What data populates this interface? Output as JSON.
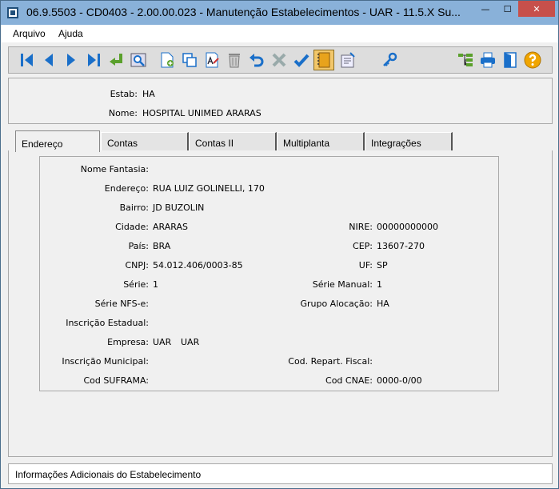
{
  "window": {
    "title": "06.9.5503 - CD0403 - 2.00.00.023 - Manutenção Estabelecimentos - UAR - 11.5.X Su...",
    "controls": {
      "minimize": "—",
      "maximize": "☐",
      "close": "✕"
    }
  },
  "menu": {
    "items": [
      "Arquivo",
      "Ajuda"
    ]
  },
  "toolbar": {
    "icons": [
      "first-record-icon",
      "previous-record-icon",
      "next-record-icon",
      "last-record-icon",
      "goto-icon",
      "search-icon",
      "add-icon",
      "copy-icon",
      "edit-icon",
      "delete-icon",
      "undo-icon",
      "cancel-icon",
      "confirm-icon",
      "notebook-icon",
      "report-icon",
      "key-icon",
      "hierarchy-icon",
      "print-icon",
      "exit-icon",
      "help-icon"
    ]
  },
  "header": {
    "estab_label": "Estab:",
    "estab_value": "HA",
    "nome_label": "Nome:",
    "nome_value": "HOSPITAL UNIMED ARARAS"
  },
  "tabs": [
    {
      "label": "Endereço",
      "selected": true
    },
    {
      "label": "Contas",
      "selected": false
    },
    {
      "label": "Contas II",
      "selected": false
    },
    {
      "label": "Multiplanta",
      "selected": false
    },
    {
      "label": "Integrações",
      "selected": false
    }
  ],
  "form": {
    "nome_fantasia_label": "Nome Fantasia:",
    "nome_fantasia_value": "",
    "endereco_label": "Endereço:",
    "endereco_value": "RUA LUIZ GOLINELLI, 170",
    "bairro_label": "Bairro:",
    "bairro_value": "JD BUZOLIN",
    "cidade_label": "Cidade:",
    "cidade_value": "ARARAS",
    "nire_label": "NIRE:",
    "nire_value": "00000000000",
    "pais_label": "País:",
    "pais_value": "BRA",
    "cep_label": "CEP:",
    "cep_value": "13607-270",
    "cnpj_label": "CNPJ:",
    "cnpj_value": "54.012.406/0003-85",
    "uf_label": "UF:",
    "uf_value": "SP",
    "serie_label": "Série:",
    "serie_value": "1",
    "serie_manual_label": "Série Manual:",
    "serie_manual_value": "1",
    "serie_nfse_label": "Série NFS-e:",
    "serie_nfse_value": "",
    "grupo_alocacao_label": "Grupo Alocação:",
    "grupo_alocacao_value": "HA",
    "inscricao_estadual_label": "Inscrição Estadual:",
    "inscricao_estadual_value": "",
    "empresa_label": "Empresa:",
    "empresa_value": "UAR",
    "empresa_desc": "UAR",
    "inscricao_municipal_label": "Inscrição Municipal:",
    "inscricao_municipal_value": "",
    "cod_repart_fiscal_label": "Cod. Repart. Fiscal:",
    "cod_repart_fiscal_value": "",
    "cod_suframa_label": "Cod SUFRAMA:",
    "cod_suframa_value": "",
    "cod_cnae_label": "Cod CNAE:",
    "cod_cnae_value": "0000-0/00"
  },
  "status": {
    "text": "Informações Adicionais do Estabelecimento"
  },
  "colors": {
    "titlebar": "#89b1d9",
    "accent": "#1a6fc9",
    "close": "#c7504b"
  }
}
